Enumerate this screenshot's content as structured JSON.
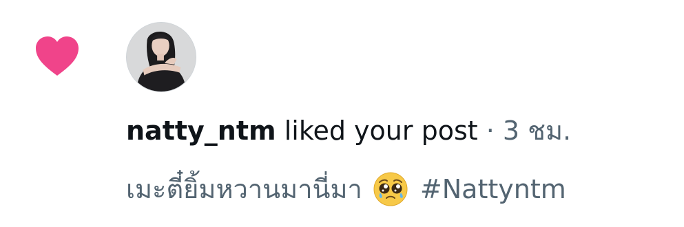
{
  "notification": {
    "icon": "heart-icon",
    "icon_color": "#f0448a",
    "avatar": "user-avatar-photo",
    "username": "natty_ntm",
    "action_text": "liked your post",
    "separator": "·",
    "time": "3 ชม.",
    "post_text": "เมะตี๋ยิ้มหวานมานี่มา",
    "emoji": "pleading-face-emoji",
    "hashtag": "#Nattyntm",
    "text_color": "#0f1419",
    "secondary_color": "#536471"
  }
}
